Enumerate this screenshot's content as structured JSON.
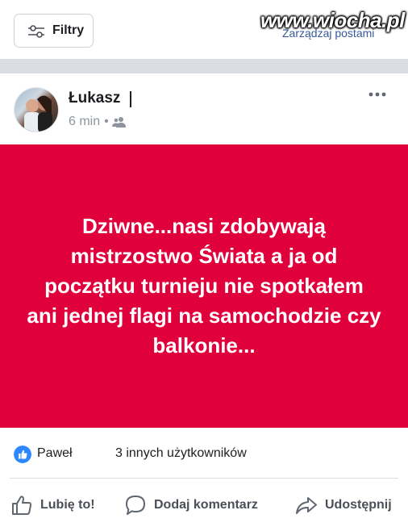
{
  "toolbar": {
    "filter_label": "Filtry",
    "manage_posts_label": "Zarządzaj postami"
  },
  "watermark": "www.wiocha.pl",
  "post": {
    "author": "Łukasz",
    "time": "6 min",
    "time_separator": "•",
    "audience_icon": "friends-icon",
    "message": "Dziwne...nasi zdobywają mistrzostwo Świata a ja od początku turnieju nie spotkałem ani jednej flagi na samochodzie czy balkonie...",
    "banner_color": "#e0003b"
  },
  "reactions": {
    "reactor": "Paweł",
    "others": "3 innych użytkowników"
  },
  "actions": {
    "like": "Lubię to!",
    "comment": "Dodaj komentarz",
    "share": "Udostępnij"
  },
  "colors": {
    "link": "#385898",
    "like_blue": "#2d88ff",
    "separator": "#dadde1"
  }
}
